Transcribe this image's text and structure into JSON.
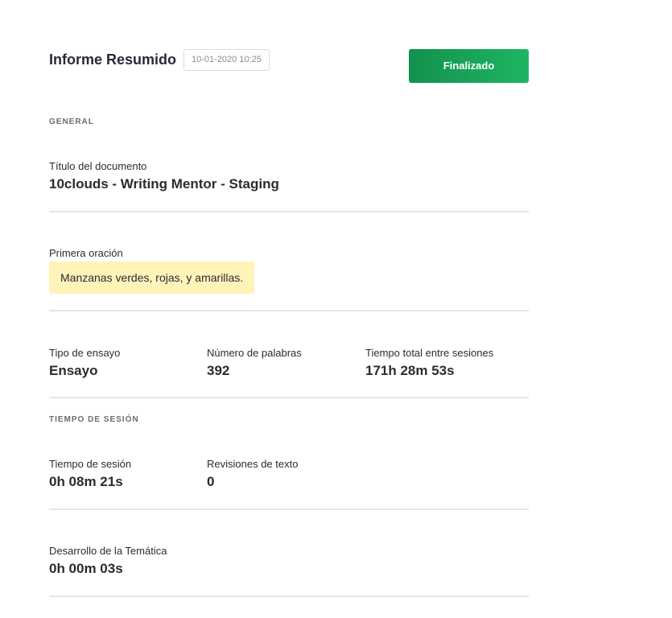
{
  "header": {
    "title": "Informe Resumido",
    "timestamp": "10-01-2020 10:25",
    "status_label": "Finalizado"
  },
  "general": {
    "heading": "GENERAL",
    "document_title_label": "Título del documento",
    "document_title_value": "10clouds - Writing Mentor - Staging",
    "first_sentence_label": "Primera oración",
    "first_sentence_value": "Manzanas verdes, rojas, y amarillas.",
    "essay_type_label": "Tipo de ensayo",
    "essay_type_value": "Ensayo",
    "word_count_label": "Número de palabras",
    "word_count_value": "392",
    "total_time_label": "Tiempo total entre sesiones",
    "total_time_value": "171h 28m 53s"
  },
  "session": {
    "heading": "TIEMPO DE SESIÓN",
    "session_time_label": "Tiempo de sesión",
    "session_time_value": "0h 08m 21s",
    "revisions_label": "Revisiones de texto",
    "revisions_value": "0",
    "topic_development_label": "Desarrollo de la Temática",
    "topic_development_value": "0h 00m 03s"
  },
  "colors": {
    "accent": "#1aa85a",
    "highlight": "#fff4b8"
  }
}
